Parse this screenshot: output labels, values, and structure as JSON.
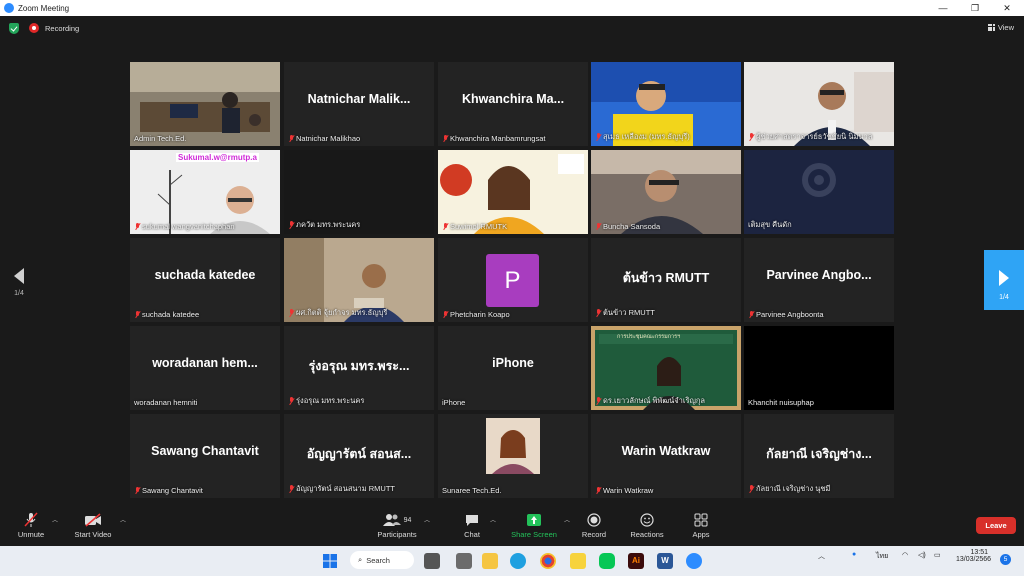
{
  "window": {
    "title": "Zoom Meeting",
    "minimize": "—",
    "maximize": "❐",
    "close": "✕"
  },
  "topbar": {
    "recording": "Recording",
    "view": "View"
  },
  "pagination": {
    "left": "1/4",
    "right": "1/4"
  },
  "tiles": [
    {
      "big": "",
      "label": "Admin Tech.Ed.",
      "muted": false,
      "scene": "room"
    },
    {
      "big": "Natnichar  Malik...",
      "label": "Natnichar Malikhao",
      "muted": true
    },
    {
      "big": "Khwanchira  Ma...",
      "label": "Khwanchira Manbamrungsat",
      "muted": true
    },
    {
      "big": "",
      "label": "สุเมธ เหลืองม (มทร.ธัญบุรี)",
      "muted": true,
      "scene": "yellow"
    },
    {
      "big": "",
      "label": "ผู้ช่วยศาสตราจารย์ธวัชชัยนิ นิ่มนวล",
      "muted": true,
      "scene": "man"
    },
    {
      "big": "",
      "label": "sukumal wangvanitchaphan",
      "muted": true,
      "scene": "sukumal",
      "overlay": "Sukumal.w@rmutp.a"
    },
    {
      "big": "",
      "label": "ภควัต มทร.พระนคร",
      "muted": true,
      "scene": "dark"
    },
    {
      "big": "",
      "label": "Suwimol RMUTK",
      "muted": true,
      "scene": "rmutk"
    },
    {
      "big": "",
      "label": "Buncha Sansoda",
      "muted": true,
      "scene": "office"
    },
    {
      "big": "",
      "label": "เติมสุข คืนดัก",
      "muted": false,
      "scene": "obs"
    },
    {
      "big": "suchada katedee",
      "label": "suchada katedee",
      "muted": true
    },
    {
      "big": "",
      "label": "ผศ.กิตติ จุ้ยกำจร มทร.ธัญบุรี",
      "muted": true,
      "scene": "desk"
    },
    {
      "big": "",
      "label": "Phetcharin Koapo",
      "muted": true,
      "scene": "avatar",
      "avatar": "P"
    },
    {
      "big": "ต้นข้าว RMUTT",
      "label": "ต้นข้าว RMUTT",
      "muted": true
    },
    {
      "big": "Parvinee  Angbo...",
      "label": "Parvinee Angboonta",
      "muted": true
    },
    {
      "big": "woradanan  hem...",
      "label": "woradanan hemniti",
      "muted": false
    },
    {
      "big": "รุ่งอรุณ มทร.พระ...",
      "label": "รุ่งอรุณ มทร.พระนคร",
      "muted": true
    },
    {
      "big": "iPhone",
      "label": "iPhone",
      "muted": false
    },
    {
      "big": "",
      "label": "ดร.เยาวลักษณ์ พิพัฒน์จำเริญกุล",
      "muted": true,
      "scene": "board",
      "overlay": "การประชุมคณะกรรมการฯ"
    },
    {
      "big": "",
      "label": "Khanchit nuisuphap",
      "muted": false,
      "scene": "black"
    },
    {
      "big": "Sawang Chantavit",
      "label": "Sawang Chantavit",
      "muted": true
    },
    {
      "big": "อัญญารัตน์ สอนส...",
      "label": "อัญญารัตน์ สอนสนาม RMUTT",
      "muted": true
    },
    {
      "big": "",
      "label": "Sunaree Tech.Ed.",
      "muted": false,
      "scene": "photo"
    },
    {
      "big": "Warin Watkraw",
      "label": "Warin Watkraw",
      "muted": true
    },
    {
      "big": "กัลยาณี เจริญช่าง...",
      "label": "กัลยาณี เจริญช่าง นุชมี",
      "muted": true
    }
  ],
  "toolbar": {
    "unmute": "Unmute",
    "start_video": "Start Video",
    "participants": "Participants",
    "participants_count": "94",
    "chat": "Chat",
    "share": "Share Screen",
    "record": "Record",
    "reactions": "Reactions",
    "apps": "Apps",
    "leave": "Leave"
  },
  "taskbar": {
    "search": "Search",
    "lang": "ไทย",
    "time": "13:51",
    "date": "13/03/2566",
    "notif": "5"
  },
  "colors": {
    "share": "#23c25a",
    "leave": "#d8302a",
    "active_border": "#c8e14f",
    "avatar": "#a83dbf",
    "nav": "#2fa4f5"
  }
}
